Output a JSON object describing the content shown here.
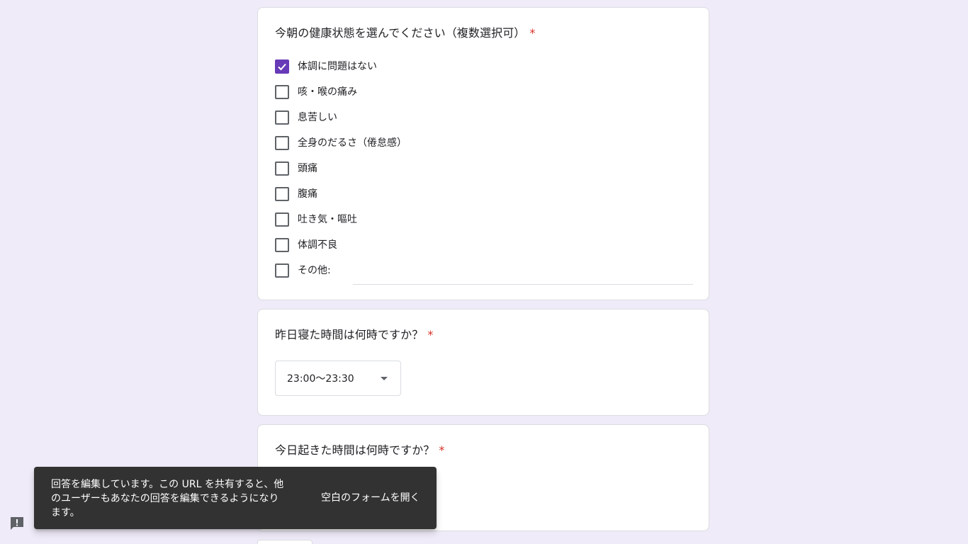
{
  "q1": {
    "title": "今朝の健康状態を選んでください（複数選択可）",
    "required_mark": "*",
    "options": [
      {
        "label": "体調に問題はない",
        "checked": true
      },
      {
        "label": "咳・喉の痛み",
        "checked": false
      },
      {
        "label": "息苦しい",
        "checked": false
      },
      {
        "label": "全身のだるさ（倦怠感）",
        "checked": false
      },
      {
        "label": "頭痛",
        "checked": false
      },
      {
        "label": "腹痛",
        "checked": false
      },
      {
        "label": "吐き気・嘔吐",
        "checked": false
      },
      {
        "label": "体調不良",
        "checked": false
      },
      {
        "label": "その他:",
        "checked": false
      }
    ]
  },
  "q2": {
    "title": "昨日寝た時間は何時ですか？",
    "required_mark": "*",
    "selected_value": "23:00～23:30"
  },
  "q3": {
    "title": "今日起きた時間は何時ですか？",
    "required_mark": "*"
  },
  "snackbar": {
    "message": "回答を編集しています。この URL を共有すると、他のユーザーもあなたの回答を編集できるようになります。",
    "action_label": "空白のフォームを開く"
  },
  "colors": {
    "background": "#f0ebf8",
    "accent": "#673ab7",
    "required": "#d93025",
    "snackbar": "#323232"
  }
}
